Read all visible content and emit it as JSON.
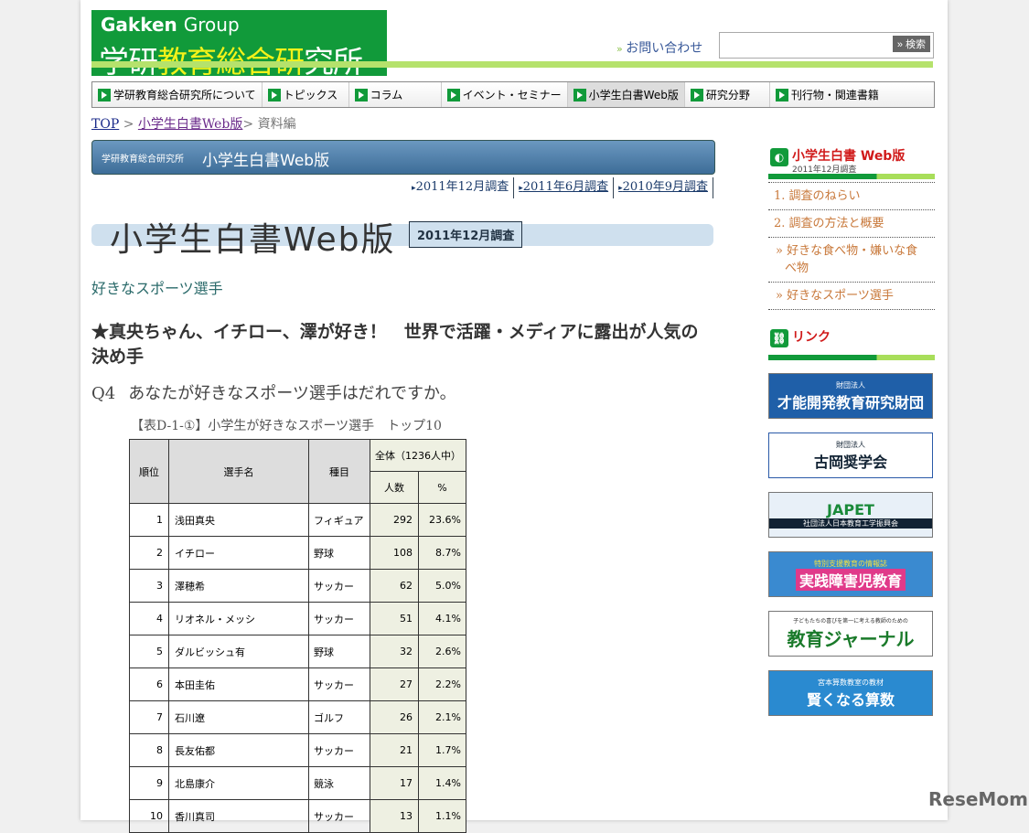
{
  "header": {
    "logo_group": "Gakken",
    "logo_group2": "Group",
    "logo_name_1": "学研",
    "logo_name_2": "教育総合",
    "logo_name_3": "研",
    "logo_name_4": "究所",
    "contact": "お問い合わせ",
    "search_button": "検索",
    "search_placeholder": ""
  },
  "nav": [
    "学研教育総合研究所について",
    "トピックス",
    "コラム",
    "イベント・セミナー",
    "小学生白書Web版",
    "研究分野",
    "刊行物・関連書籍"
  ],
  "breadcrumb": {
    "top": "TOP",
    "sep": ">",
    "section": "小学生白書Web版",
    "current": "資料編"
  },
  "band": {
    "small": "学研教育総合研究所",
    "title": "小学生白書Web版"
  },
  "surveys": [
    "2011年12月調査",
    "2011年6月調査",
    "2010年9月調査"
  ],
  "title": {
    "main": "小学生白書Web版",
    "date": "2011年12月調査"
  },
  "section": "好きなスポーツ選手",
  "headline": "★真央ちゃん、イチロー、澤が好き！　世界で活躍・メディアに露出が人気の決め手",
  "question": {
    "label": "Q4",
    "text": "あなたが好きなスポーツ選手はだれですか。"
  },
  "table": {
    "caption": "【表D-1-①】小学生が好きなスポーツ選手　トップ10",
    "headers": {
      "rank": "順位",
      "name": "選手名",
      "sport": "種目",
      "total": "全体（1236人中）",
      "count": "人数",
      "pct": "%"
    },
    "rows": [
      {
        "rank": "1",
        "name": "浅田真央",
        "sport": "フィギュア",
        "count": "292",
        "pct": "23.6%"
      },
      {
        "rank": "2",
        "name": "イチロー",
        "sport": "野球",
        "count": "108",
        "pct": "8.7%"
      },
      {
        "rank": "3",
        "name": "澤穂希",
        "sport": "サッカー",
        "count": "62",
        "pct": "5.0%"
      },
      {
        "rank": "4",
        "name": "リオネル・メッシ",
        "sport": "サッカー",
        "count": "51",
        "pct": "4.1%"
      },
      {
        "rank": "5",
        "name": "ダルビッシュ有",
        "sport": "野球",
        "count": "32",
        "pct": "2.6%"
      },
      {
        "rank": "6",
        "name": "本田圭佑",
        "sport": "サッカー",
        "count": "27",
        "pct": "2.2%"
      },
      {
        "rank": "7",
        "name": "石川遼",
        "sport": "ゴルフ",
        "count": "26",
        "pct": "2.1%"
      },
      {
        "rank": "8",
        "name": "長友佑都",
        "sport": "サッカー",
        "count": "21",
        "pct": "1.7%"
      },
      {
        "rank": "9",
        "name": "北島康介",
        "sport": "競泳",
        "count": "17",
        "pct": "1.4%"
      },
      {
        "rank": "10",
        "name": "香川真司",
        "sport": "サッカー",
        "count": "13",
        "pct": "1.1%"
      }
    ]
  },
  "sidebar": {
    "title": "小学生白書 Web版",
    "subtitle": "2011年12月調査",
    "menu": [
      "1.  調査のねらい",
      "2.  調査の方法と概要",
      "» 好きな食べ物・嫌いな食べ物",
      "» 好きなスポーツ選手"
    ],
    "links_title": "リンク",
    "banners": [
      {
        "small": "財団法人",
        "big": "才能開発教育研究財団"
      },
      {
        "small": "財団法人",
        "big": "古岡奨学会"
      },
      {
        "small": "社団法人日本教育工学振興会",
        "big": "JAPET"
      },
      {
        "small": "特別支援教育の情報誌",
        "big": "実践障害児教育"
      },
      {
        "small": "子どもたちの喜びを第一に考える教師のための",
        "big": "教育ジャーナル"
      },
      {
        "small": "宮本算数教室の教材",
        "big": "賢くなる算数"
      }
    ]
  },
  "watermark": "ReseMom"
}
